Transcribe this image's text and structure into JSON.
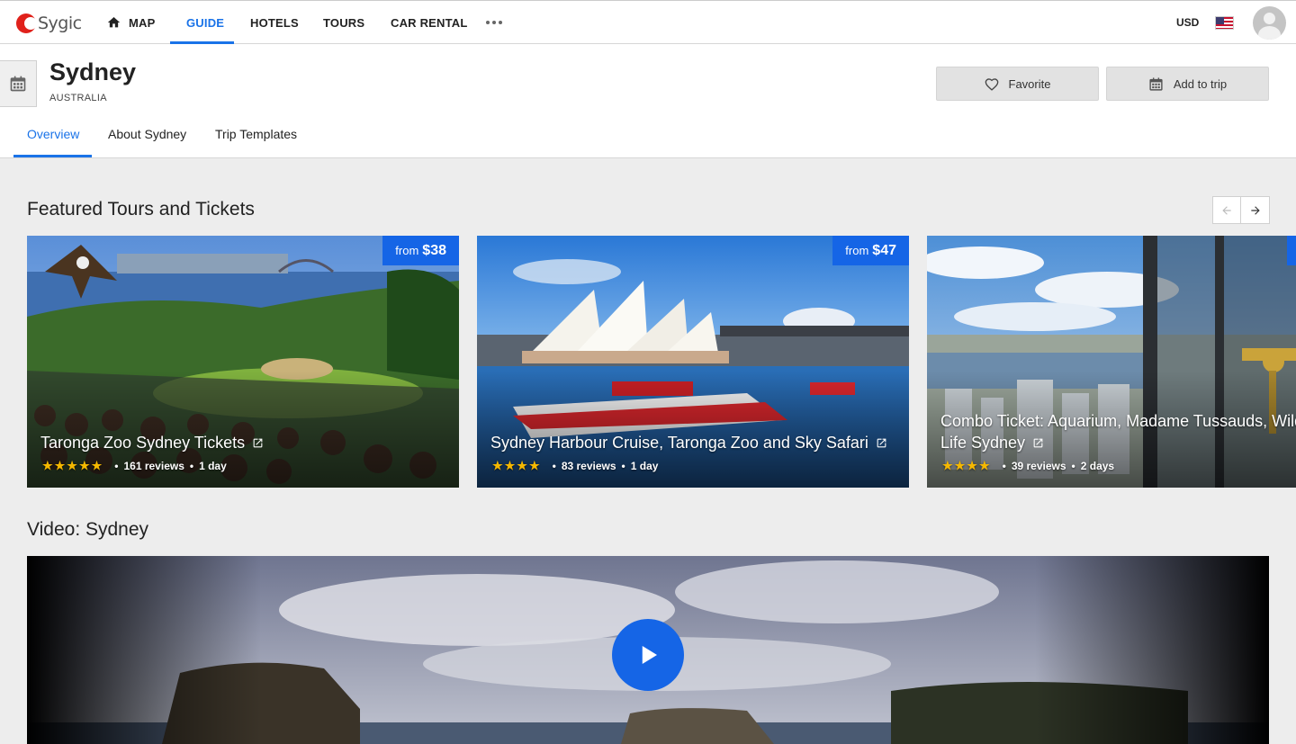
{
  "topnav": {
    "logo_text": "Sygic",
    "items": [
      {
        "label": "MAP"
      },
      {
        "label": "GUIDE"
      },
      {
        "label": "HOTELS"
      },
      {
        "label": "TOURS"
      },
      {
        "label": "CAR RENTAL"
      }
    ],
    "currency": "USD",
    "accent_color": "#1a73e8"
  },
  "header": {
    "title": "Sydney",
    "country": "AUSTRALIA",
    "favorite_label": "Favorite",
    "add_to_trip_label": "Add to trip",
    "tabs": [
      {
        "label": "Overview"
      },
      {
        "label": "About Sydney"
      },
      {
        "label": "Trip Templates"
      }
    ]
  },
  "featured": {
    "title": "Featured Tours and Tickets",
    "cards": [
      {
        "price_prefix": "from",
        "price": "$38",
        "title": "Taronga Zoo Sydney Tickets",
        "stars": "★★★★★",
        "reviews": "161 reviews",
        "duration": "1 day"
      },
      {
        "price_prefix": "from",
        "price": "$47",
        "title": "Sydney Harbour Cruise, Taronga Zoo and Sky Safari",
        "stars": "★★★★",
        "reviews": "83 reviews",
        "duration": "1 day"
      },
      {
        "price_prefix": "",
        "price": "",
        "title": "Combo Ticket: Aquarium, Madame Tussauds, Wild Life Sydney",
        "stars": "★★★★",
        "reviews": "39 reviews",
        "duration": "2 days"
      }
    ]
  },
  "video": {
    "title": "Video: Sydney"
  }
}
